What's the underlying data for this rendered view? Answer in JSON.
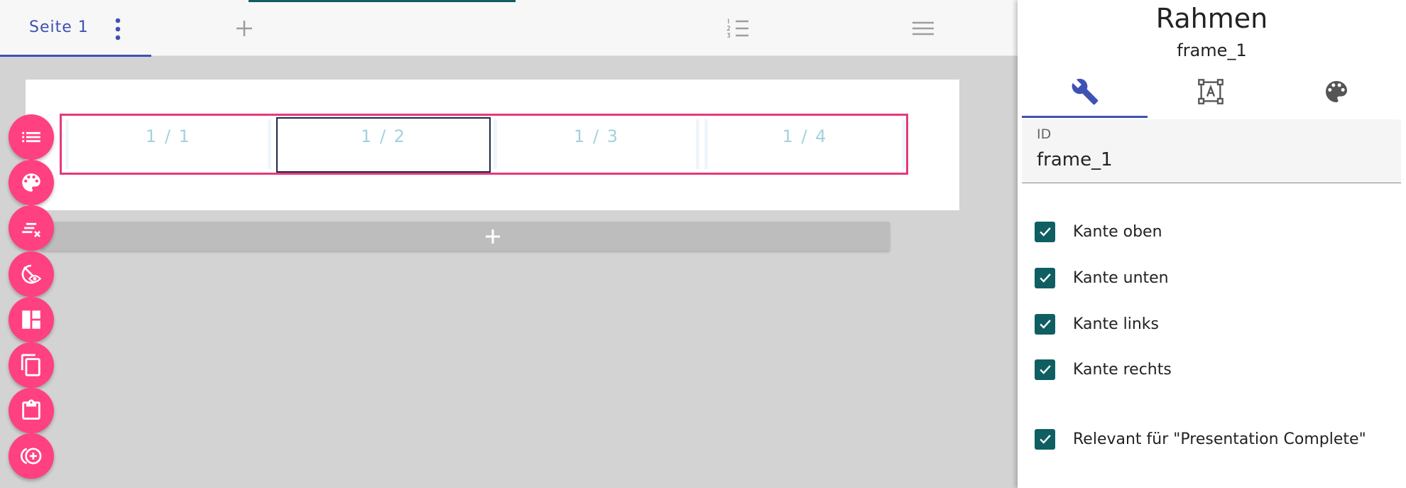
{
  "toolbar": {
    "tab_label": "Seite 1",
    "icons": [
      "more-vert-icon",
      "add-icon",
      "numbered-list-icon",
      "menu-icon"
    ]
  },
  "canvas": {
    "cells": [
      {
        "label": "1 / 1",
        "selected": false
      },
      {
        "label": "1 / 2",
        "selected": true
      },
      {
        "label": "1 / 3",
        "selected": false
      },
      {
        "label": "1 / 4",
        "selected": false
      }
    ],
    "add_row_icon": "add-icon"
  },
  "fabs": [
    "list-icon",
    "palette-icon",
    "clear-list-icon",
    "visibility-icon",
    "layout-icon",
    "copy-icon",
    "clipboard-icon",
    "add-circle-icon"
  ],
  "panel": {
    "title": "Rahmen",
    "subtitle": "frame_1",
    "tabs": [
      {
        "icon": "wrench-icon",
        "active": true
      },
      {
        "icon": "text-frame-icon",
        "active": false
      },
      {
        "icon": "palette-icon",
        "active": false
      }
    ],
    "id_field": {
      "label": "ID",
      "value": "frame_1"
    },
    "checkboxes": [
      {
        "label": "Kante oben",
        "checked": true
      },
      {
        "label": "Kante unten",
        "checked": true
      },
      {
        "label": "Kante links",
        "checked": true
      },
      {
        "label": "Kante rechts",
        "checked": true
      },
      {
        "label": "Relevant für \"Presentation Complete\"",
        "checked": true
      }
    ]
  },
  "colors": {
    "accent_indigo": "#3f51b5",
    "fab_pink": "#ff4081",
    "frame_border": "#e6397a",
    "checkbox_teal": "#0f5f62",
    "cell_text": "#a3d1de",
    "canvas_bg": "#d3d3d3"
  }
}
